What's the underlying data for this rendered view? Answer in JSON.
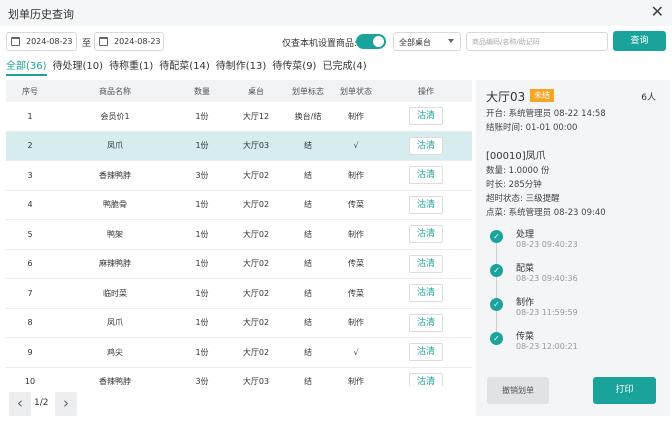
{
  "window": {
    "title": "划单历史查询"
  },
  "filters": {
    "date_from": "2024-08-23",
    "to_label": "至",
    "date_to": "2024-08-23",
    "toggle_label": "仅查本机设置商品:",
    "toggle_on": true,
    "table_select": "全部桌台",
    "search_placeholder": "商品编码/名称/助记码",
    "search_value": "",
    "search_button": "查询"
  },
  "tabs": [
    {
      "label": "全部(36)",
      "active": true
    },
    {
      "label": "待处理(10)",
      "active": false
    },
    {
      "label": "待称重(1)",
      "active": false
    },
    {
      "label": "待配菜(14)",
      "active": false
    },
    {
      "label": "待制作(13)",
      "active": false
    },
    {
      "label": "待传菜(9)",
      "active": false
    },
    {
      "label": "已完成(4)",
      "active": false
    }
  ],
  "table": {
    "columns": [
      "序号",
      "商品名称",
      "数量",
      "桌台",
      "划单标志",
      "划单状态",
      "操作"
    ],
    "clear_label": "沽清",
    "rows": [
      {
        "no": "1",
        "name": "会员价1",
        "qty": "1份",
        "table": "大厅12",
        "flag": "换台/结",
        "status": "制作",
        "selected": false
      },
      {
        "no": "2",
        "name": "凤爪",
        "qty": "1份",
        "table": "大厅03",
        "flag": "结",
        "status": "√",
        "selected": true
      },
      {
        "no": "3",
        "name": "香辣鸭脖",
        "qty": "3份",
        "table": "大厅02",
        "flag": "结",
        "status": "制作",
        "selected": false
      },
      {
        "no": "4",
        "name": "鸭脆骨",
        "qty": "1份",
        "table": "大厅02",
        "flag": "结",
        "status": "传菜",
        "selected": false
      },
      {
        "no": "5",
        "name": "鸭架",
        "qty": "1份",
        "table": "大厅02",
        "flag": "结",
        "status": "制作",
        "selected": false
      },
      {
        "no": "6",
        "name": "麻辣鸭脖",
        "qty": "1份",
        "table": "大厅02",
        "flag": "结",
        "status": "传菜",
        "selected": false
      },
      {
        "no": "7",
        "name": "临时菜",
        "qty": "1份",
        "table": "大厅02",
        "flag": "结",
        "status": "传菜",
        "selected": false
      },
      {
        "no": "8",
        "name": "凤爪",
        "qty": "1份",
        "table": "大厅02",
        "flag": "结",
        "status": "制作",
        "selected": false
      },
      {
        "no": "9",
        "name": "鸡尖",
        "qty": "1份",
        "table": "大厅02",
        "flag": "结",
        "status": "√",
        "selected": false
      },
      {
        "no": "10",
        "name": "香辣鸭脖",
        "qty": "3份",
        "table": "大厅03",
        "flag": "结",
        "status": "制作",
        "selected": false
      }
    ]
  },
  "pager": {
    "text": "1/2"
  },
  "detail": {
    "table_name": "大厅03",
    "badge": "未结",
    "people": "6人",
    "open_info": "开台: 系统管理员 08-22 14:58",
    "checkout_time": "结账时间: 01-01 00:00",
    "dish": "[00010]凤爪",
    "qty": "数量: 1.0000 份",
    "duration": "时长: 285分钟",
    "overtime": "超时状态: 三级提醒",
    "order_info": "点菜: 系统管理员 08-23 09:40",
    "timeline": [
      {
        "name": "处理",
        "time": "08-23 09:40:23"
      },
      {
        "name": "配菜",
        "time": "08-23 09:40:36"
      },
      {
        "name": "制作",
        "time": "08-23 11:59:59"
      },
      {
        "name": "传菜",
        "time": "08-23 12:00:21"
      }
    ],
    "cancel_button": "撤销划单",
    "print_button": "打印"
  },
  "colors": {
    "accent": "#1aa39a",
    "badge": "#f5a623",
    "selected_row": "#d6ecee"
  }
}
